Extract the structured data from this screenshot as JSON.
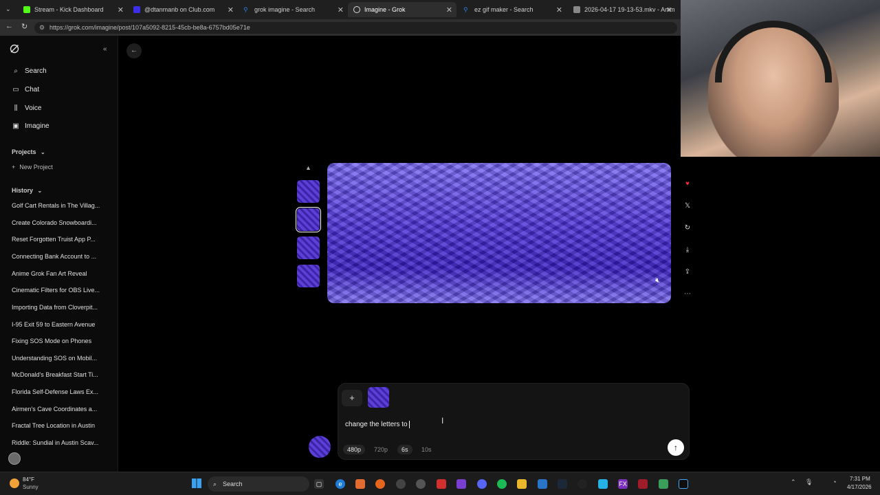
{
  "browser": {
    "tabs": [
      {
        "label": "Stream - Kick Dashboard",
        "color": "#53fc18"
      },
      {
        "label": "@dtanmanb on Club.com",
        "color": "#3d2ee8"
      },
      {
        "label": "grok imagine - Search",
        "color": "#2d7be0"
      },
      {
        "label": "Imagine - Grok",
        "color": "#dddddd"
      },
      {
        "label": "ez gif maker - Search",
        "color": "#2d7be0"
      },
      {
        "label": "2026-04-17 19-13-53.mkv - Anim",
        "color": "#cccccc"
      }
    ],
    "url": "https://grok.com/imagine/post/107a5092-8215-45cb-be8a-6757bd05e71e"
  },
  "sidebar": {
    "nav": [
      {
        "label": "Search",
        "icon": "search-icon"
      },
      {
        "label": "Chat",
        "icon": "chat-icon"
      },
      {
        "label": "Voice",
        "icon": "voice-icon"
      },
      {
        "label": "Imagine",
        "icon": "image-icon"
      }
    ],
    "projects_label": "Projects",
    "new_project_label": "New Project",
    "history_label": "History",
    "history": [
      "Golf Cart Rentals in The Villag...",
      "Create Colorado Snowboardi...",
      "Reset Forgotten Truist App P...",
      "Connecting Bank Account to ...",
      "Anime Grok Fan Art Reveal",
      "Cinematic Filters for OBS Live...",
      "Importing Data from Cloverpit...",
      "I-95 Exit 59 to Eastern Avenue",
      "Fixing SOS Mode on Phones",
      "Understanding SOS on Mobil...",
      "McDonald's Breakfast Start Ti...",
      "Florida Self-Defense Laws Ex...",
      "Airmen's Cave Coordinates a...",
      "Fractal Tree Location in Austin",
      "Riddle: Sundial in Austin Scav..."
    ]
  },
  "composer": {
    "input_value": "change the letters to",
    "resolutions": [
      "480p",
      "720p"
    ],
    "durations": [
      "6s",
      "10s"
    ],
    "selected_resolution": "480p",
    "selected_duration": "6s"
  },
  "taskbar": {
    "weather_temp": "84°F",
    "weather_desc": "Sunny",
    "search_label": "Search",
    "time": "7:31 PM",
    "date": "4/17/2026"
  },
  "colors": {
    "accent_purple": "#4f35d8",
    "like_red": "#e0303a"
  }
}
